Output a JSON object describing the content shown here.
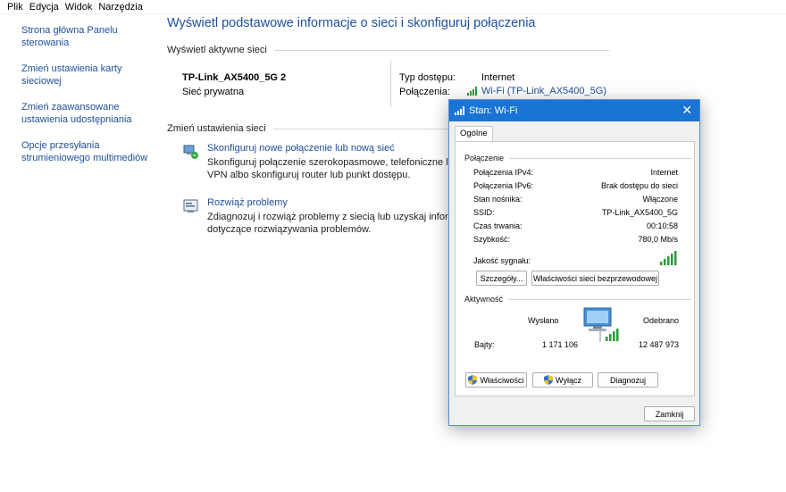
{
  "menu": [
    "Plik",
    "Edycja",
    "Widok",
    "Narzędzia"
  ],
  "sidebar": {
    "items": [
      {
        "label": "Strona główna Panelu sterowania"
      },
      {
        "label": "Zmień ustawienia karty sieciowej"
      },
      {
        "label": "Zmień zaawansowane ustawienia udostępniania"
      },
      {
        "label": "Opcje przesyłania strumieniowego multimediów"
      }
    ]
  },
  "main": {
    "title": "Wyświetl podstawowe informacje o sieci i skonfiguruj połączenia",
    "active_header": "Wyświetl aktywne sieci",
    "network_name": "TP-Link_AX5400_5G 2",
    "network_type": "Sieć prywatna",
    "access_label": "Typ dostępu:",
    "access_value": "Internet",
    "connections_label": "Połączenia:",
    "connections_value": "Wi-Fi (TP-Link_AX5400_5G)",
    "change_header": "Zmień ustawienia sieci",
    "tasks": [
      {
        "link": "Skonfiguruj nowe połączenie lub nową sieć",
        "desc": "Skonfiguruj połączenie szerokopasmowe, telefoniczne lub VPN albo skonfiguruj router lub punkt dostępu."
      },
      {
        "link": "Rozwiąż problemy",
        "desc": "Zdiagnozuj i rozwiąż problemy z siecią lub uzyskaj informacje dotyczące rozwiązywania problemów."
      }
    ]
  },
  "dialog": {
    "title": "Stan: Wi-Fi",
    "tab": "Ogólne",
    "connection_header": "Połączenie",
    "rows": [
      {
        "label": "Połączenia IPv4:",
        "value": "Internet"
      },
      {
        "label": "Połączenia IPv6:",
        "value": "Brak dostępu do sieci"
      },
      {
        "label": "Stan nośnika:",
        "value": "Włączone"
      },
      {
        "label": "SSID:",
        "value": "TP-Link_AX5400_5G"
      },
      {
        "label": "Czas trwania:",
        "value": "00:10:58"
      },
      {
        "label": "Szybkość:",
        "value": "780,0 Mb/s"
      }
    ],
    "signal_label": "Jakość sygnału:",
    "signal_bars": 5,
    "details_button": "Szczegóły...",
    "wireless_props_button": "Właściwości sieci bezprzewodowej",
    "activity_header": "Aktywność",
    "sent_label": "Wysłano",
    "received_label": "Odebrano",
    "bytes_label": "Bajty:",
    "bytes_sent": "1 171 106",
    "bytes_received": "12 487 973",
    "properties_button": "Właściwości",
    "disable_button": "Wyłącz",
    "diagnose_button": "Diagnozuj",
    "close_button": "Zamknij"
  },
  "colors": {
    "link": "#1f4e9c",
    "titlebar": "#1a74d4",
    "signal": "#2e9a3a"
  }
}
